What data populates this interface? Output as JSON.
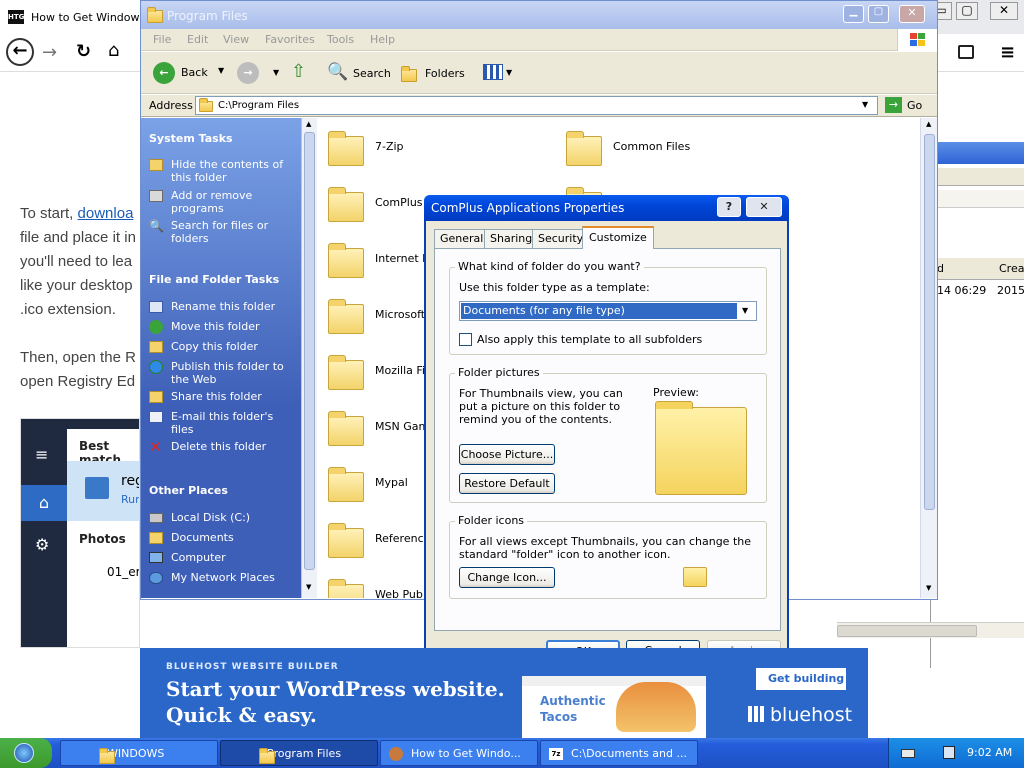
{
  "browser": {
    "tab_title": "How to Get Windows",
    "favicon_text": "HTG"
  },
  "article": {
    "line1_pre": "To start, ",
    "line1_link": "downloa",
    "line2": "file and place it in",
    "line3": "you'll need to lea",
    "line4": "like your desktop",
    "line5": ".ico extension.",
    "line6": "Then, open the R",
    "line7": "open Registry Ed"
  },
  "search_panel": {
    "best_match": "Best match",
    "result_title": "reg",
    "result_sub": "Run",
    "photos": "Photos",
    "photo_item": "01_er"
  },
  "back_window": {
    "col1": "d",
    "col2": "Creat",
    "row_date": "14 06:29",
    "row_year": "2015-"
  },
  "explorer": {
    "title": "Program Files",
    "menu": [
      "File",
      "Edit",
      "View",
      "Favorites",
      "Tools",
      "Help"
    ],
    "toolbar": {
      "back": "Back",
      "search": "Search",
      "folders": "Folders"
    },
    "address_label": "Address",
    "address_value": "C:\\Program Files",
    "go": "Go",
    "system_tasks": {
      "title": "System Tasks",
      "items": [
        "Hide the contents of this folder",
        "Add or remove programs",
        "Search for files or folders"
      ]
    },
    "file_tasks": {
      "title": "File and Folder Tasks",
      "items": [
        "Rename this folder",
        "Move this folder",
        "Copy this folder",
        "Publish this folder to the Web",
        "Share this folder",
        "E-mail this folder's files",
        "Delete this folder"
      ]
    },
    "other_places": {
      "title": "Other Places",
      "items": [
        "Local Disk (C:)",
        "Documents",
        "Computer",
        "My Network Places"
      ]
    },
    "folders_col1": [
      "7-Zip",
      "ComPlus",
      "Internet E",
      "Microsoft",
      "Mozilla Fi",
      "MSN Gam",
      "Mypal",
      "Reference",
      "Web Pub"
    ],
    "folders_col2": [
      "Common Files"
    ]
  },
  "dialog": {
    "title": "ComPlus Applications Properties",
    "tabs": [
      "General",
      "Sharing",
      "Security",
      "Customize"
    ],
    "group1_title": "What kind of folder do you want?",
    "template_label": "Use this folder type as a template:",
    "template_value": "Documents (for any file type)",
    "also_apply": "Also apply this template to all subfolders",
    "group2_title": "Folder pictures",
    "pictures_text": "For Thumbnails view, you can put a picture on this folder to remind you of the contents.",
    "preview_label": "Preview:",
    "choose_picture": "Choose Picture...",
    "restore_default": "Restore Default",
    "group3_title": "Folder icons",
    "icons_text": "For all views except Thumbnails, you can change the standard \"folder\" icon to another icon.",
    "change_icon": "Change Icon...",
    "ok": "OK",
    "cancel": "Cancel",
    "apply": "Apply"
  },
  "ad": {
    "eyebrow": "BLUEHOST WEBSITE BUILDER",
    "headline1": "Start your WordPress website.",
    "headline2": "Quick & easy.",
    "card_line1": "Authentic",
    "card_line2": "Tacos",
    "cta": "Get building",
    "brand": "bluehost"
  },
  "taskbar": {
    "items": [
      "WINDOWS",
      "Program Files",
      "How to Get Windo...",
      "C:\\Documents and ..."
    ],
    "clock": "9:02 AM"
  },
  "colors": {
    "xp_blue": "#0a246a",
    "title_active": "#0054e3",
    "sidebar_blue": "#3e5fb7",
    "taskbar": "#245edb",
    "start_green": "#3c9a2c",
    "ad_blue": "#2a67c9"
  }
}
